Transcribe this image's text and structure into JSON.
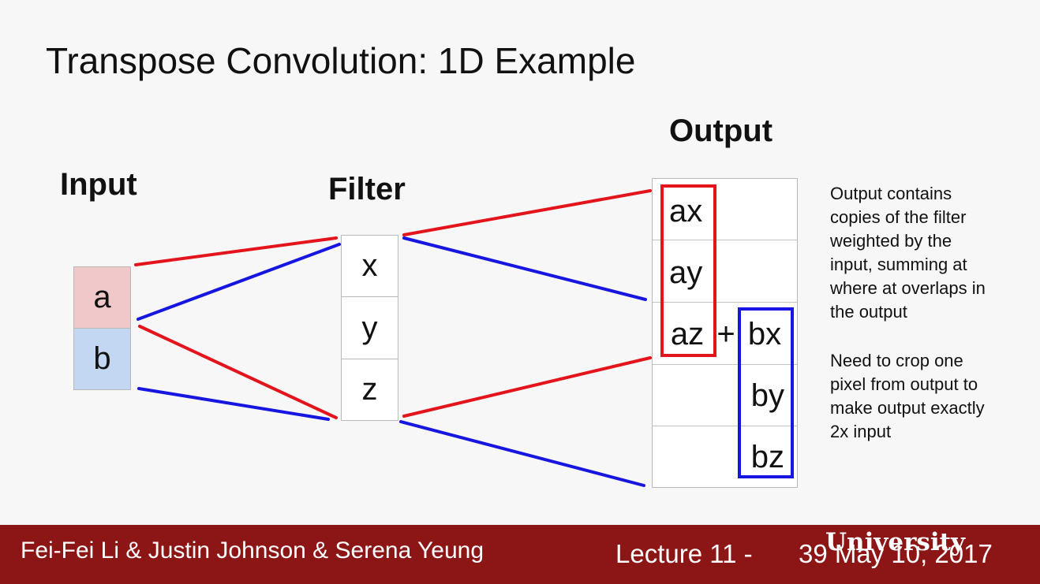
{
  "title": "Transpose Convolution: 1D Example",
  "labels": {
    "input": "Input",
    "filter": "Filter",
    "output": "Output"
  },
  "input_cells": [
    "a",
    "b"
  ],
  "filter_cells": [
    "x",
    "y",
    "z"
  ],
  "output_a_cells": [
    "ax",
    "ay",
    "az"
  ],
  "output_plus": "+",
  "output_b_cells": [
    "bx",
    "by",
    "bz"
  ],
  "notes": {
    "overlap_lines": [
      "Output contains",
      "copies of the filter",
      "weighted by the",
      "input, summing at",
      "where at overlaps in",
      "the output"
    ],
    "crop_lines": [
      "Need to crop one",
      "pixel from output to",
      "make output exactly",
      "2x input"
    ]
  },
  "footer": {
    "authors": "Fei-Fei Li & Justin Johnson & Serena Yeung",
    "lecture": "Lecture 11 -",
    "page_date": "39   May 10, 2017",
    "watermark": "University"
  },
  "colors": {
    "input_a": "#f0c8c9",
    "input_b": "#c4d7f2",
    "red": "#e3141b",
    "blue": "#1616e0",
    "footer": "#8c1515"
  }
}
